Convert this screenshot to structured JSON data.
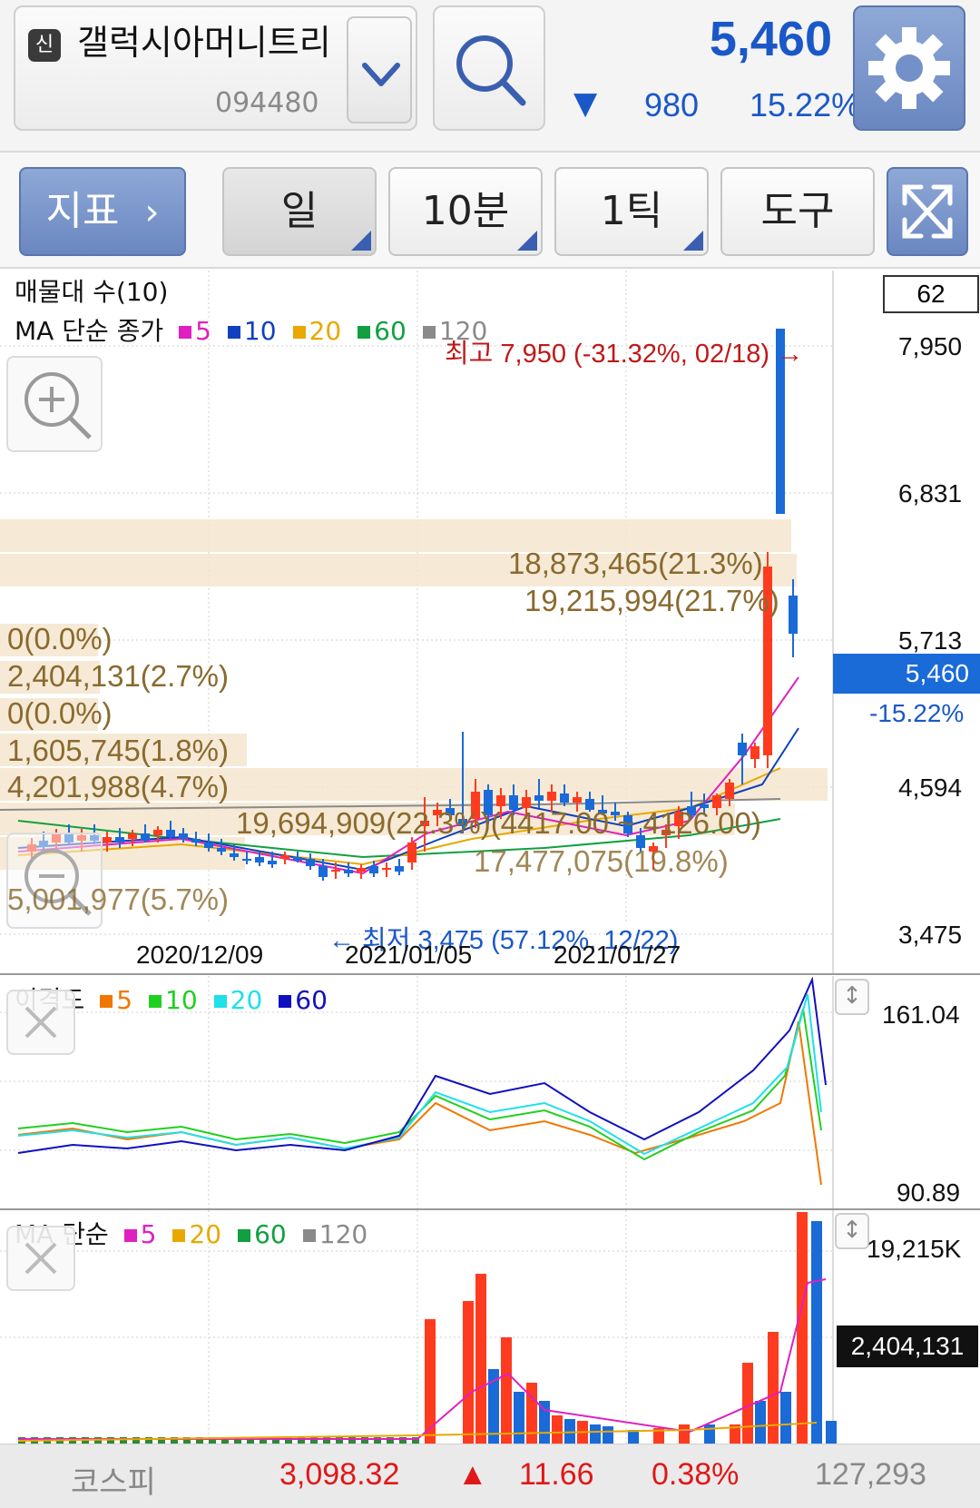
{
  "header": {
    "badge": "신",
    "stock_name": "갤럭시아머니트리",
    "stock_code": "094480",
    "price": "5,460",
    "direction_symbol": "▼",
    "change": "980",
    "change_pct": "15.22%",
    "icons": {
      "dropdown": "chevron-down-icon",
      "search": "search-icon",
      "settings": "gear-icon"
    }
  },
  "toolbar": {
    "indicator_label": "지표",
    "period_label": "일",
    "minute_label": "10분",
    "tick_label": "1틱",
    "tools_label": "도구",
    "expand_icon": "expand-icon"
  },
  "main_chart": {
    "volume_profile_label": "매물대 수(10)",
    "ma_label": "MA 단순 종가",
    "ma_legend": [
      {
        "label": "5",
        "color": "#e020c0"
      },
      {
        "label": "10",
        "color": "#1040c0"
      },
      {
        "label": "20",
        "color": "#e8a800"
      },
      {
        "label": "60",
        "color": "#10a040"
      },
      {
        "label": "120",
        "color": "#8a8a8a"
      }
    ],
    "count_box": "62",
    "high_annotation": "최고 7,950 (-31.32%, 02/18) →",
    "low_annotation": "← 최저 3,475 (57.12%, 12/22)",
    "current_price_tag": "5,460",
    "current_change_tag": "-15.22%",
    "price_axis": [
      "7,950",
      "6,831",
      "5,713",
      "4,594",
      "3,475"
    ],
    "date_axis": [
      "2020/12/09",
      "2021/01/05",
      "2021/01/27"
    ],
    "volume_profile": [
      "18,873,465(21.3%)",
      "19,215,994(21.7%)",
      "0(0.0%)",
      "2,404,131(2.7%)",
      "0(0.0%)",
      "1,605,745(1.8%)",
      "4,201,988(4.7%)",
      "19,694,909(22.3%)(4417.00 ~ 4126.00)",
      "17,477,075(19.8%)",
      "5,001,977(5.7%)"
    ],
    "colors": {
      "up": "#ff3b1f",
      "down": "#1a6ad8",
      "band": "#f5e6cf"
    }
  },
  "disparity_chart": {
    "label": "이격도",
    "legend": [
      {
        "label": "5",
        "color": "#f07800"
      },
      {
        "label": "10",
        "color": "#20d020"
      },
      {
        "label": "20",
        "color": "#20e0e8"
      },
      {
        "label": "60",
        "color": "#1010c0"
      }
    ],
    "axis": [
      "161.04",
      "90.89"
    ]
  },
  "volume_chart": {
    "label": "MA 단순",
    "legend": [
      {
        "label": "5",
        "color": "#e020c0"
      },
      {
        "label": "20",
        "color": "#e8a800"
      },
      {
        "label": "60",
        "color": "#10a040"
      },
      {
        "label": "120",
        "color": "#8a8a8a"
      }
    ],
    "axis_top": "19,215K",
    "current_tag": "2,404,131"
  },
  "footer": {
    "index_name": "코스피",
    "index_value": "3,098.32",
    "direction_symbol": "▲",
    "change": "11.66",
    "change_pct": "0.38%",
    "volume": "127,293"
  }
}
